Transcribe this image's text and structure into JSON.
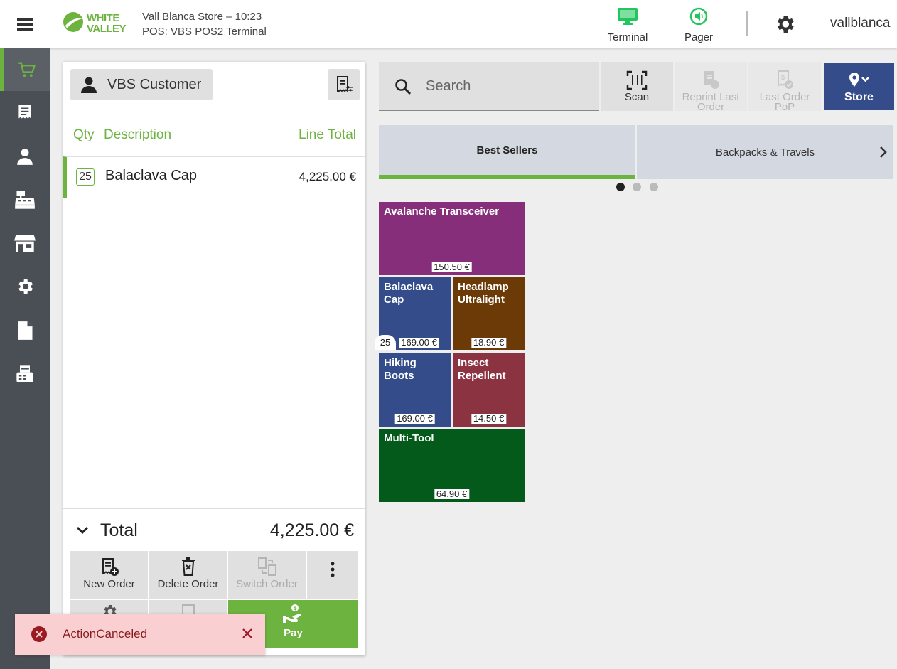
{
  "header": {
    "logo": {
      "line1": "WHITE",
      "line2": "VALLEY"
    },
    "store_line": "Vall Blanca Store – 10:23",
    "pos_line": "POS: VBS POS2 Terminal",
    "terminal_label": "Terminal",
    "pager_label": "Pager",
    "user": "vallblanca",
    "accent": "#6db33f"
  },
  "sidebar": {
    "items": [
      {
        "icon": "cart-icon",
        "active": true
      },
      {
        "icon": "receipt-icon"
      },
      {
        "icon": "person-icon"
      },
      {
        "icon": "cash-register-icon"
      },
      {
        "icon": "store-icon"
      },
      {
        "icon": "gear-icon"
      },
      {
        "icon": "document-icon"
      },
      {
        "icon": "printer-icon"
      }
    ]
  },
  "order": {
    "customer": "VBS Customer",
    "columns": {
      "qty": "Qty",
      "description": "Description",
      "line_total": "Line Total"
    },
    "lines": [
      {
        "qty": "25",
        "description": "Balaclava Cap",
        "total": "4,225.00 €"
      }
    ],
    "total_label": "Total",
    "total_value": "4,225.00 €"
  },
  "actions": {
    "new_order": "New Order",
    "delete_order": "Delete Order",
    "switch_order": "Switch Order",
    "pay": "Pay"
  },
  "toolbar": {
    "search_placeholder": "Search",
    "scan": "Scan",
    "reprint_last_order": "Reprint Last Order",
    "last_order_pop": "Last Order PoP",
    "store": "Store"
  },
  "categories": {
    "tabs": [
      "Best Sellers",
      "Backpacks & Travels"
    ],
    "active": 0,
    "page_dots": 3
  },
  "products": [
    {
      "name": "Avalanche Transceiver",
      "price": "150.50 €",
      "color": "#862e7a"
    },
    {
      "name": "Balaclava Cap",
      "price": "169.00 €",
      "color": "#344d8a",
      "qty": "25"
    },
    {
      "name": "Headlamp Ultralight",
      "price": "18.90 €",
      "color": "#6b3a06"
    },
    {
      "name": "Hiking Boots",
      "price": "169.00 €",
      "color": "#344d8a"
    },
    {
      "name": "Insect Repellent",
      "price": "14.50 €",
      "color": "#8b3340"
    },
    {
      "name": "Multi-Tool",
      "price": "64.90 €",
      "color": "#035a1a"
    }
  ],
  "toast": {
    "message": "ActionCanceled",
    "color": "#f9cfd1"
  }
}
